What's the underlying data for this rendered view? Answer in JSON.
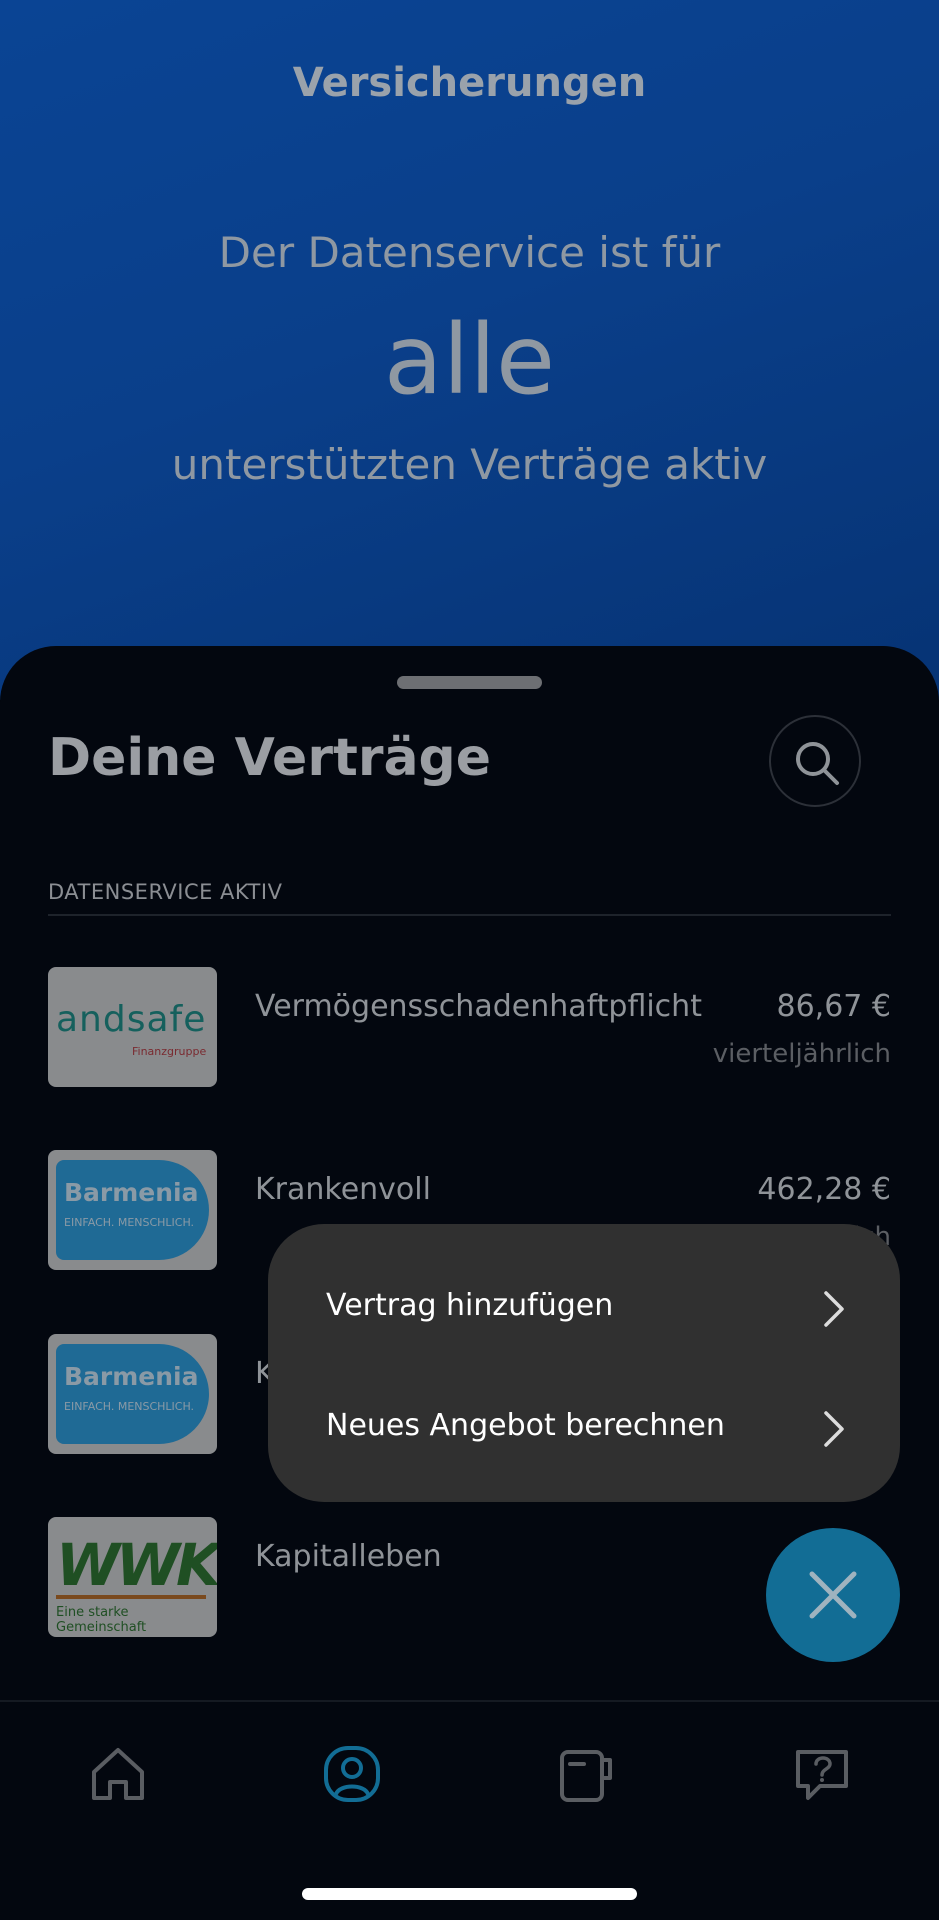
{
  "hero": {
    "title": "Versicherungen",
    "line1": "Der Datenservice ist für",
    "highlight": "alle",
    "line3": "unterstützten Verträge aktiv"
  },
  "sheet": {
    "title": "Deine Verträge",
    "section_label": "DATENSERVICE AKTIV",
    "contracts": [
      {
        "provider": "andsafe",
        "provider_sub": "Finanzgruppe",
        "name": "Vermögensschadenhaftpflicht",
        "price": "86,67 €",
        "frequency": "vierteljährlich"
      },
      {
        "provider": "Barmenia",
        "provider_sub": "EINFACH. MENSCHLICH.",
        "name": "Krankenvoll",
        "price": "462,28 €",
        "frequency": "monatlich"
      },
      {
        "provider": "Barmenia",
        "provider_sub": "EINFACH. MENSCHLICH.",
        "name": "K",
        "price": "",
        "frequency": ""
      },
      {
        "provider": "WWK",
        "provider_sub": "Eine starke Gemeinschaft",
        "name": "Kapitalleben",
        "price": "",
        "frequency": ""
      }
    ]
  },
  "menu": {
    "items": [
      {
        "label": "Vertrag hinzufügen"
      },
      {
        "label": "Neues Angebot berechnen"
      }
    ]
  },
  "tabs": [
    {
      "icon": "home-icon",
      "active": false
    },
    {
      "icon": "contracts-icon",
      "active": true
    },
    {
      "icon": "documents-icon",
      "active": false
    },
    {
      "icon": "help-icon",
      "active": false
    }
  ],
  "colors": {
    "accent": "#126d95",
    "hero_blue": "#0a4494",
    "menu_bg": "#303030"
  }
}
